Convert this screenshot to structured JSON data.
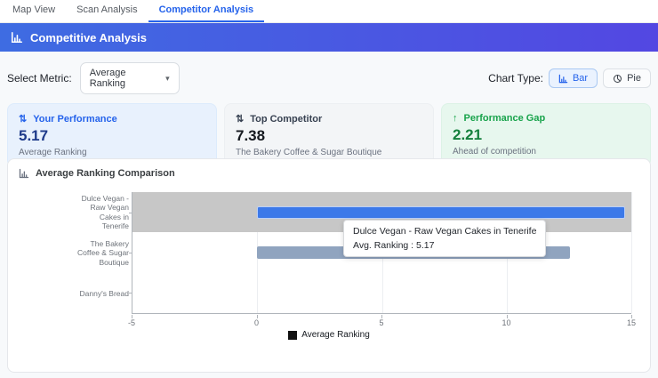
{
  "tabs": [
    {
      "label": "Map View",
      "active": false
    },
    {
      "label": "Scan Analysis",
      "active": false
    },
    {
      "label": "Competitor Analysis",
      "active": true
    }
  ],
  "header": {
    "title": "Competitive Analysis",
    "icon": "bar-chart-icon"
  },
  "controls": {
    "metric_label": "Select Metric:",
    "metric_value": "Average Ranking",
    "caret_glyph": "▾",
    "chart_type_label": "Chart Type:",
    "bar_button_label": "Bar",
    "pie_button_label": "Pie"
  },
  "cards": [
    {
      "icon_glyph": "⇅",
      "icon": "up-down-arrows-icon",
      "title": "Your Performance",
      "value": "5.17",
      "subtitle": "Average Ranking",
      "theme": "blue"
    },
    {
      "icon_glyph": "⇅",
      "icon": "up-down-arrows-icon",
      "title": "Top Competitor",
      "value": "7.38",
      "subtitle": "The Bakery Coffee & Sugar Boutique",
      "theme": "neutral"
    },
    {
      "icon_glyph": "↑",
      "icon": "up-arrow-icon",
      "title": "Performance Gap",
      "value": "2.21",
      "subtitle": "Ahead of competition",
      "theme": "green"
    }
  ],
  "chart_panel": {
    "title": "Average Ranking Comparison"
  },
  "chart_data": {
    "type": "bar",
    "orientation": "horizontal",
    "title": "Average Ranking Comparison",
    "series_name": "Average Ranking",
    "categories": [
      "Dulce Vegan - Raw Vegan Cakes in Tenerife",
      "The Bakery Coffee & Sugar Boutique",
      "Danny's Bread"
    ],
    "category_lines": [
      [
        "Dulce Vegan -",
        "Raw Vegan",
        "Cakes in",
        "Tenerife"
      ],
      [
        "The Bakery",
        "Coffee & Sugar",
        "Boutique"
      ],
      [
        "Danny's Bread"
      ]
    ],
    "values": [
      5.17,
      7.38,
      0
    ],
    "values_rendered": [
      14.75,
      12.55,
      0
    ],
    "bar_colors": [
      "#3c79e9",
      "#90a4bf",
      "#90a4bf"
    ],
    "highlight_index": 0,
    "highlight_band_color": "#c7c7c7",
    "xlim": [
      -5,
      15
    ],
    "xticks": [
      -5,
      0,
      5,
      10,
      15
    ],
    "grid": true,
    "legend_position": "bottom",
    "tooltip": {
      "title": "Dulce Vegan - Raw Vegan Cakes in Tenerife",
      "value_line": "Avg. Ranking : 5.17"
    }
  }
}
